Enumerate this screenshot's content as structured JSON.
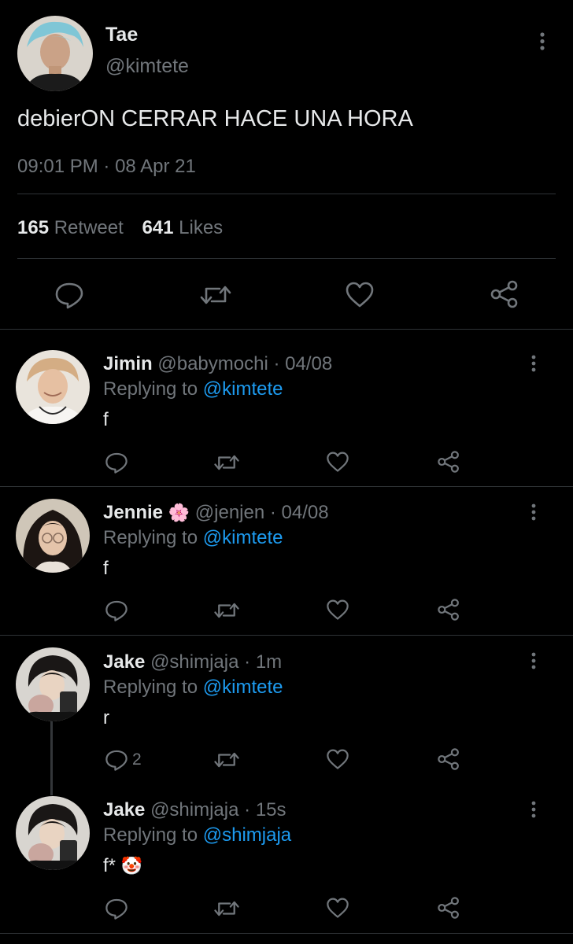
{
  "main_tweet": {
    "author_name": "Tae",
    "author_handle": "@kimtete",
    "text": "debierON CERRAR HACE UNA HORA",
    "time": "09:01 PM",
    "date_sep": "·",
    "date": "08 Apr 21",
    "retweets_count": "165",
    "retweets_label": "Retweet",
    "likes_count": "641",
    "likes_label": "Likes"
  },
  "replies": [
    {
      "name": "Jimin",
      "handle": "@babymochi",
      "sep": "·",
      "time": "04/08",
      "replying_prefix": "Replying to",
      "replying_to": "@kimtete",
      "text": "f"
    },
    {
      "name": "Jennie",
      "emoji": "🌸",
      "handle": "@jenjen",
      "sep": "·",
      "time": "04/08",
      "replying_prefix": "Replying to",
      "replying_to": "@kimtete",
      "text": "f"
    },
    {
      "name": "Jake",
      "handle": "@shimjaja",
      "sep": "·",
      "time": "1m",
      "replying_prefix": "Replying to",
      "replying_to": "@kimtete",
      "text": "r",
      "reply_count": "2"
    },
    {
      "name": "Jake",
      "handle": "@shimjaja",
      "sep": "·",
      "time": "15s",
      "replying_prefix": "Replying to",
      "replying_to": "@shimjaja",
      "text": "f*",
      "emoji": "🤡"
    }
  ],
  "icons": {
    "reply": "reply-icon",
    "retweet": "retweet-icon",
    "like": "heart-icon",
    "share": "share-icon",
    "menu": "more-vertical-icon"
  },
  "colors": {
    "background": "#000000",
    "text": "#e7e9ea",
    "muted": "#71767b",
    "link": "#1d9bf0",
    "divider": "#2f3336"
  }
}
